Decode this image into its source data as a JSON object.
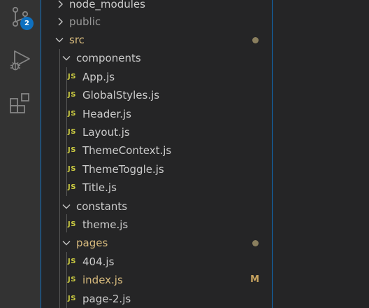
{
  "activity_bar": {
    "source_control_badge": "2",
    "icons": [
      "source-control-icon",
      "run-debug-icon",
      "extensions-icon"
    ]
  },
  "explorer": {
    "rows": [
      {
        "kind": "folder",
        "state": "collapsed",
        "label": "node_modules"
      },
      {
        "kind": "folder",
        "state": "collapsed",
        "label": "public"
      },
      {
        "kind": "folder",
        "state": "expanded",
        "label": "src",
        "decoration": "dot"
      },
      {
        "kind": "folder",
        "state": "expanded",
        "label": "components"
      },
      {
        "kind": "file",
        "type": "JS",
        "label": "App.js"
      },
      {
        "kind": "file",
        "type": "JS",
        "label": "GlobalStyles.js"
      },
      {
        "kind": "file",
        "type": "JS",
        "label": "Header.js"
      },
      {
        "kind": "file",
        "type": "JS",
        "label": "Layout.js"
      },
      {
        "kind": "file",
        "type": "JS",
        "label": "ThemeContext.js"
      },
      {
        "kind": "file",
        "type": "JS",
        "label": "ThemeToggle.js"
      },
      {
        "kind": "file",
        "type": "JS",
        "label": "Title.js"
      },
      {
        "kind": "folder",
        "state": "expanded",
        "label": "constants"
      },
      {
        "kind": "file",
        "type": "JS",
        "label": "theme.js"
      },
      {
        "kind": "folder",
        "state": "expanded",
        "label": "pages",
        "decoration": "dot"
      },
      {
        "kind": "file",
        "type": "JS",
        "label": "404.js"
      },
      {
        "kind": "file",
        "type": "JS",
        "label": "index.js",
        "decoration": "M"
      },
      {
        "kind": "file",
        "type": "JS",
        "label": "page-2.js"
      }
    ]
  },
  "colors": {
    "accent": "#0e70c0",
    "js_icon": "#cbcb41",
    "modified_text": "#d7ba7d",
    "dot": "#8a7f5e",
    "text": "#cccccc"
  }
}
